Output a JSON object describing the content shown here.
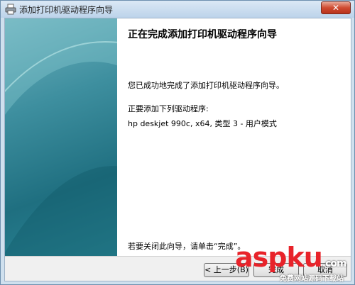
{
  "window": {
    "title": "添加打印机驱动程序向导",
    "close_label": "✕"
  },
  "wizard": {
    "heading": "正在完成添加打印机驱动程序向导",
    "success_text": "您已成功地完成了添加打印机驱动程序向导。",
    "list_label": "正要添加下列驱动程序:",
    "driver": "hp deskjet 990c, x64, 类型 3 - 用户模式",
    "close_hint": "若要关闭此向导，请单击“完成”。"
  },
  "footer": {
    "back_label": "< 上一步(B)",
    "finish_label": "完成",
    "cancel_label": "取消"
  },
  "watermark": {
    "brand": "aspku",
    "brand_suffix": ".com",
    "tagline": "免费网站源码下载站"
  },
  "colors": {
    "panel_teal": "#1f6f80",
    "watermark_red": "#e8232a"
  }
}
